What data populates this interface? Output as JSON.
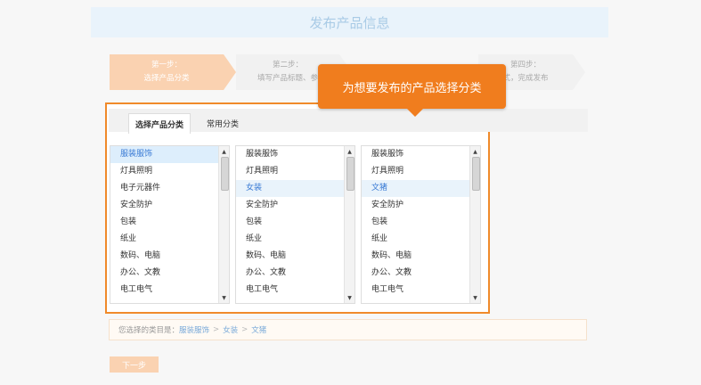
{
  "header": {
    "title": "发布产品信息"
  },
  "steps": [
    {
      "line1": "第一步：",
      "line2": "选择产品分类"
    },
    {
      "line1": "第二步：",
      "line2": "填写产品标题、参"
    },
    {
      "line1": "第四步：",
      "line2": "式，完成发布"
    }
  ],
  "tooltip": {
    "text": "为想要发布的产品选择分类"
  },
  "tabs": {
    "active": "选择产品分类",
    "inactive": "常用分类"
  },
  "lists": [
    [
      "服装服饰",
      "灯具照明",
      "电子元器件",
      "安全防护",
      "包装",
      "纸业",
      "数码、电脑",
      "办公、文教",
      "电工电气"
    ],
    [
      "服装服饰",
      "灯具照明",
      "女装",
      "安全防护",
      "包装",
      "纸业",
      "数码、电脑",
      "办公、文教",
      "电工电气"
    ],
    [
      "服装服饰",
      "灯具照明",
      "文猪",
      "安全防护",
      "包装",
      "纸业",
      "数码、电脑",
      "办公、文教",
      "电工电气"
    ]
  ],
  "selection": {
    "label": "您选择的类目是：",
    "crumbs": [
      "服装服饰",
      "女装",
      "文猪"
    ],
    "separator": ">"
  },
  "next_button": "下一步",
  "colors": {
    "accent": "#f07d1e",
    "step_active": "#fad2b1",
    "link": "#3a7bd5"
  }
}
